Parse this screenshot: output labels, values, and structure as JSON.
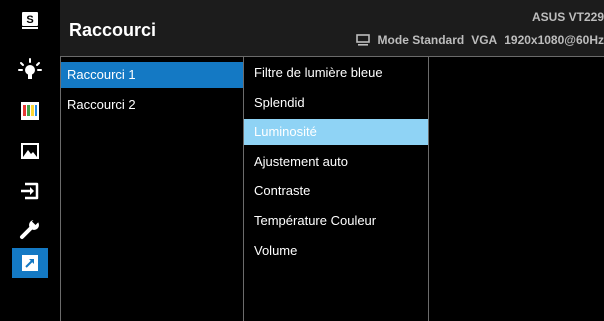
{
  "header": {
    "title": "Raccourci",
    "model": "ASUS VT229",
    "mode": "Mode Standard",
    "input": "VGA",
    "resolution": "1920x1080@60Hz"
  },
  "sidebar": {
    "icons": [
      {
        "name": "splendid-icon",
        "glyph": "S"
      },
      {
        "name": "blue-light-filter-icon"
      },
      {
        "name": "color-icon"
      },
      {
        "name": "image-icon"
      },
      {
        "name": "input-select-icon"
      },
      {
        "name": "system-setup-icon"
      },
      {
        "name": "shortcut-icon",
        "active": true
      }
    ]
  },
  "column1": {
    "items": [
      "Raccourci 1",
      "Raccourci 2"
    ],
    "selected_index": 0
  },
  "column2": {
    "items": [
      "Filtre de lumière bleue",
      "Splendid",
      "Luminosité",
      "Ajustement auto",
      "Contraste",
      "Température Couleur",
      "Volume"
    ],
    "highlighted_index": 2
  },
  "colors": {
    "accent": "#1479c4",
    "highlight": "#8fd3f5",
    "header_bg": "#1c1c1c",
    "divider": "#6b6b6b"
  }
}
